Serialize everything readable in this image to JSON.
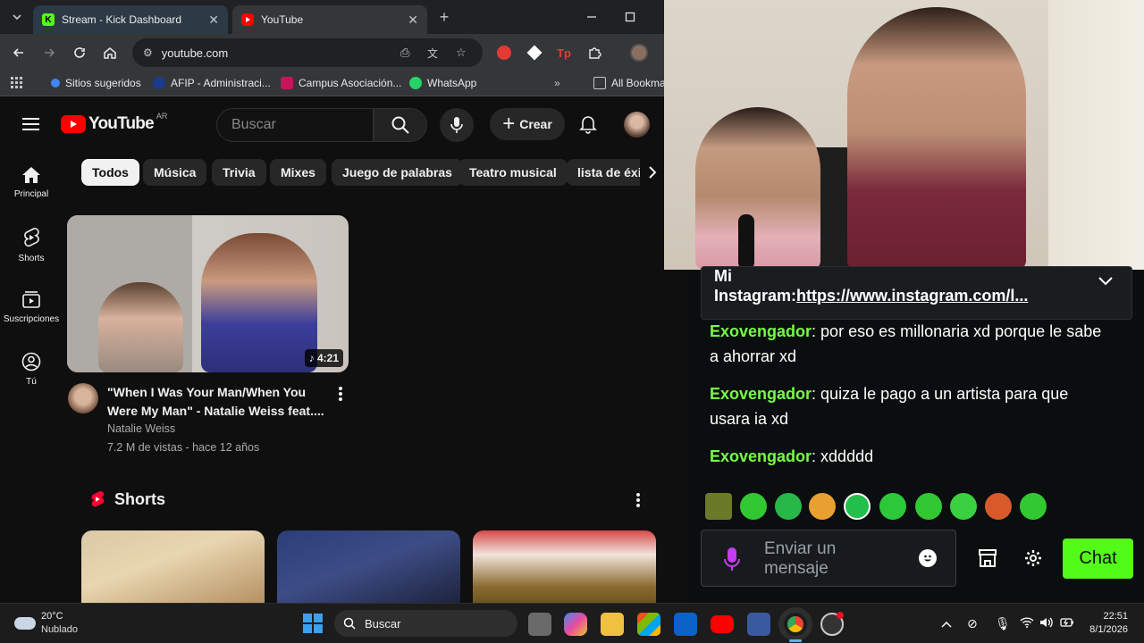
{
  "browser": {
    "tabs": [
      {
        "title": "Stream - Kick Dashboard",
        "icon": "kick-icon"
      },
      {
        "title": "YouTube",
        "icon": "youtube-icon"
      }
    ],
    "url": "youtube.com",
    "bookmarks": [
      "Sitios sugeridos",
      "AFIP - Administraci...",
      "Campus Asociación...",
      "WhatsApp",
      "All Bookma"
    ]
  },
  "youtube": {
    "logo": "YouTube",
    "region": "AR",
    "search_placeholder": "Buscar",
    "create_label": "Crear",
    "sidebar": [
      "Principal",
      "Shorts",
      "Suscripciones",
      "Tú"
    ],
    "chips": [
      "Todos",
      "Música",
      "Trivia",
      "Mixes",
      "Juego de palabras",
      "Teatro musical",
      "lista de éxit"
    ],
    "video": {
      "title": "\"When I Was Your Man/When You Were My Man\" - Natalie Weiss feat....",
      "channel": "Natalie Weiss",
      "meta": "7.2 M de vistas - hace 12 años",
      "duration": "4:21"
    },
    "shorts_heading": "Shorts"
  },
  "chat": {
    "pinned_line1": "Mi",
    "pinned_prefix": "Instagram:",
    "pinned_link": "https://www.instagram.com/l...",
    "messages": [
      {
        "user": "Exovengador",
        "text": "por eso es millonaria xd porque le sabe a ahorrar xd"
      },
      {
        "user": "Exovengador",
        "text": "quiza le pago a un artista para que usara ia xd"
      },
      {
        "user": "Exovengador",
        "text": "xddddd"
      }
    ],
    "input_placeholder": "Enviar un mensaje",
    "send_label": "Chat",
    "colors": {
      "accent": "#53fc18",
      "username": "#75fd46"
    }
  },
  "taskbar": {
    "temperature": "20°C",
    "weather": "Nublado",
    "search_label": "Buscar",
    "time": "22:51",
    "date": "8/1/2026"
  }
}
